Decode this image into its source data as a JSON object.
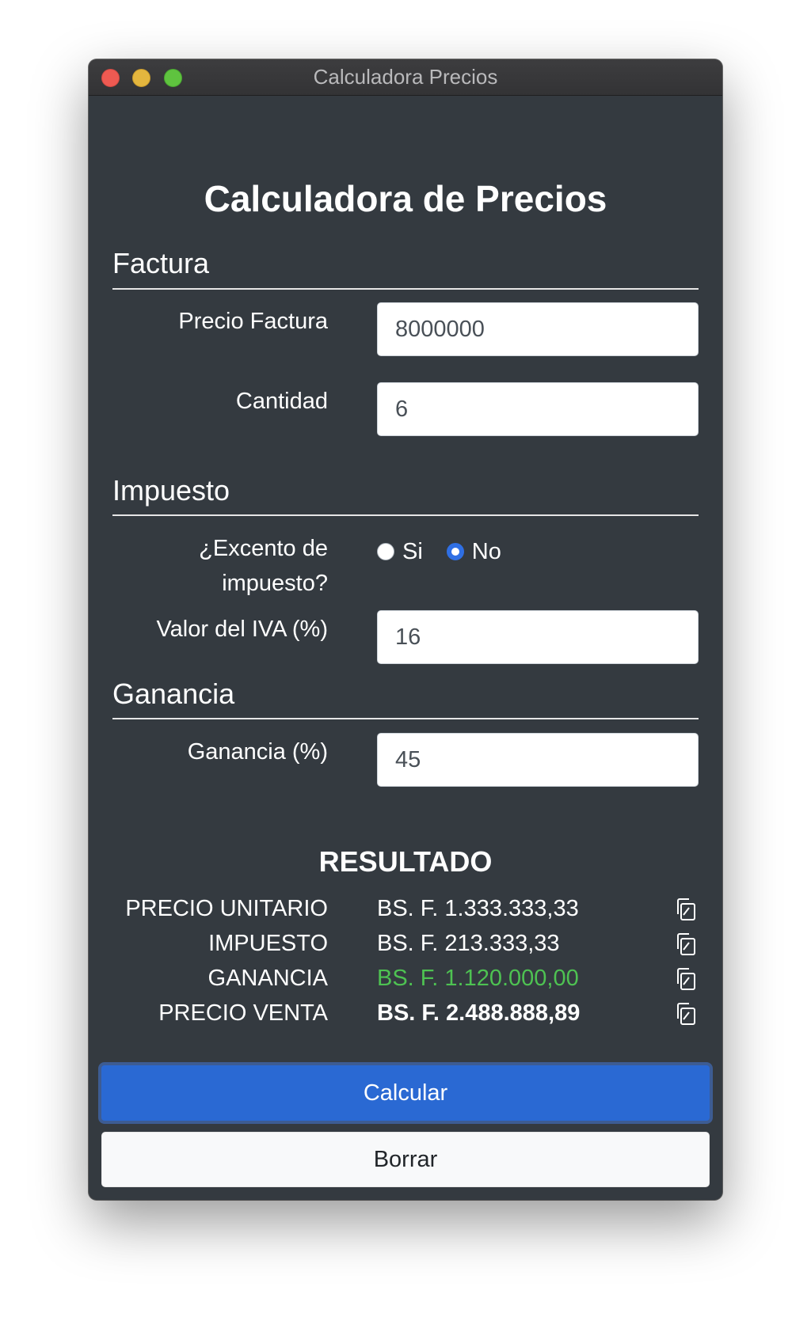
{
  "window": {
    "title": "Calculadora Precios"
  },
  "app": {
    "title": "Calculadora de Precios"
  },
  "factura": {
    "heading": "Factura",
    "precio_label": "Precio Factura",
    "precio_value": "8000000",
    "cantidad_label": "Cantidad",
    "cantidad_value": "6"
  },
  "impuesto": {
    "heading": "Impuesto",
    "excento_label_line1": "¿Excento de",
    "excento_label_line2": "impuesto?",
    "options": [
      {
        "label": "Si",
        "checked": false
      },
      {
        "label": "No",
        "checked": true
      }
    ],
    "iva_label": "Valor del IVA (%)",
    "iva_value": "16"
  },
  "ganancia": {
    "heading": "Ganancia",
    "label": "Ganancia (%)",
    "value": "45"
  },
  "resultado": {
    "heading": "RESULTADO",
    "rows": [
      {
        "label": "PRECIO UNITARIO",
        "value": "BS. F. 1.333.333,33"
      },
      {
        "label": "IMPUESTO",
        "value": "BS. F. 213.333,33"
      },
      {
        "label": "GANANCIA",
        "value": "BS. F. 1.120.000,00"
      },
      {
        "label": "PRECIO VENTA",
        "value": "BS. F. 2.488.888,89"
      }
    ],
    "profit_color": "#4ec252"
  },
  "buttons": {
    "calcular": "Calcular",
    "borrar": "Borrar"
  },
  "colors": {
    "window_bg": "#343a40",
    "primary": "#2a69d3",
    "radio_checked": "#2f6fe4"
  },
  "icons": {
    "copy": "copy-icon"
  }
}
